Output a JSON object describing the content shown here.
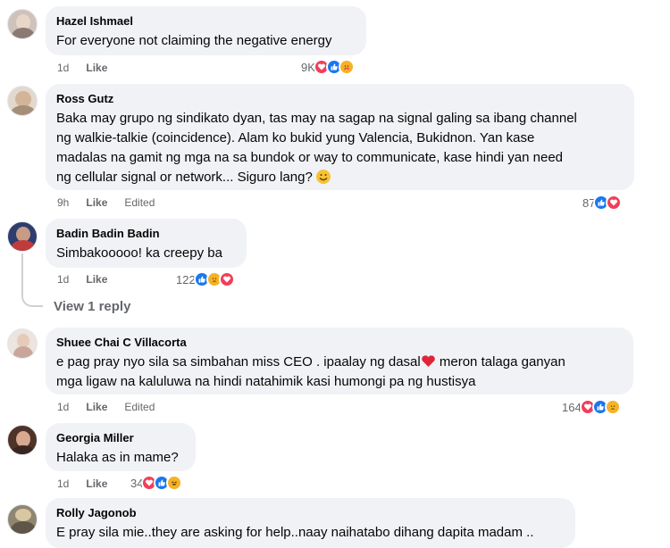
{
  "comments": [
    {
      "author": "Hazel Ishmael",
      "text": "For everyone not claiming the negative energy",
      "time": "1d",
      "like": "Like",
      "edited": "",
      "reaction_count": "9K",
      "reactions": [
        "love",
        "like",
        "care"
      ],
      "avatar_color": "#b9a7a0"
    },
    {
      "author": "Ross Gutz",
      "text_lines": [
        "Baka may grupo ng sindikato dyan, tas may na sagap na signal galing sa ibang channel",
        "ng walkie-talkie (coincidence). Alam ko bukid yung Valencia, Bukidnon. Yan kase",
        "madalas na gamit ng mga na sa bundok or way to communicate, kase hindi yan need",
        "ng cellular signal or network... Siguro lang?"
      ],
      "time": "9h",
      "like": "Like",
      "edited": "Edited",
      "reaction_count": "87",
      "reactions": [
        "like",
        "love"
      ],
      "avatar_color": "#c8b8a6"
    },
    {
      "author": "Badin Badin Badin",
      "text": "Simbakooooo! ka creepy ba",
      "time": "1d",
      "like": "Like",
      "edited": "",
      "reaction_count": "122",
      "reactions": [
        "like",
        "sad",
        "love"
      ],
      "avatar_color": "#3b4a7a"
    },
    {
      "author": "Shuee Chai C Villacorta",
      "text_lines": [
        "e pag pray nyo sila sa simbahan miss CEO . ipaalay ng dasal",
        "mga ligaw na kaluluwa na hindi natahimik kasi humongi pa ng hustisya"
      ],
      "line1_after_heart": " meron talaga ganyan",
      "time": "1d",
      "like": "Like",
      "edited": "Edited",
      "reaction_count": "164",
      "reactions": [
        "love",
        "like",
        "sad"
      ],
      "avatar_color": "#d9c7be"
    },
    {
      "author": "Georgia Miller",
      "text": "Halaka as in mame?",
      "time": "1d",
      "like": "Like",
      "edited": "",
      "reaction_count": "34",
      "reactions": [
        "love",
        "like",
        "haha"
      ],
      "avatar_color": "#6b4a3e"
    },
    {
      "author": "Rolly Jagonob",
      "text": "E pray sila mie..they are asking for help..naay naihatabo dihang dapita madam ..",
      "avatar_color": "#8a7f6a"
    }
  ],
  "view_reply": "View 1 reply",
  "colors": {
    "bubble": "#f0f2f5",
    "meta": "#65676b",
    "like_blue": "#1877f2",
    "love_red": "#f33e58",
    "emoji_yellow": "#f7b125"
  },
  "icons": {
    "like": "thumbs-up-icon",
    "love": "heart-icon",
    "care": "care-icon",
    "sad": "sad-icon",
    "haha": "haha-icon"
  }
}
